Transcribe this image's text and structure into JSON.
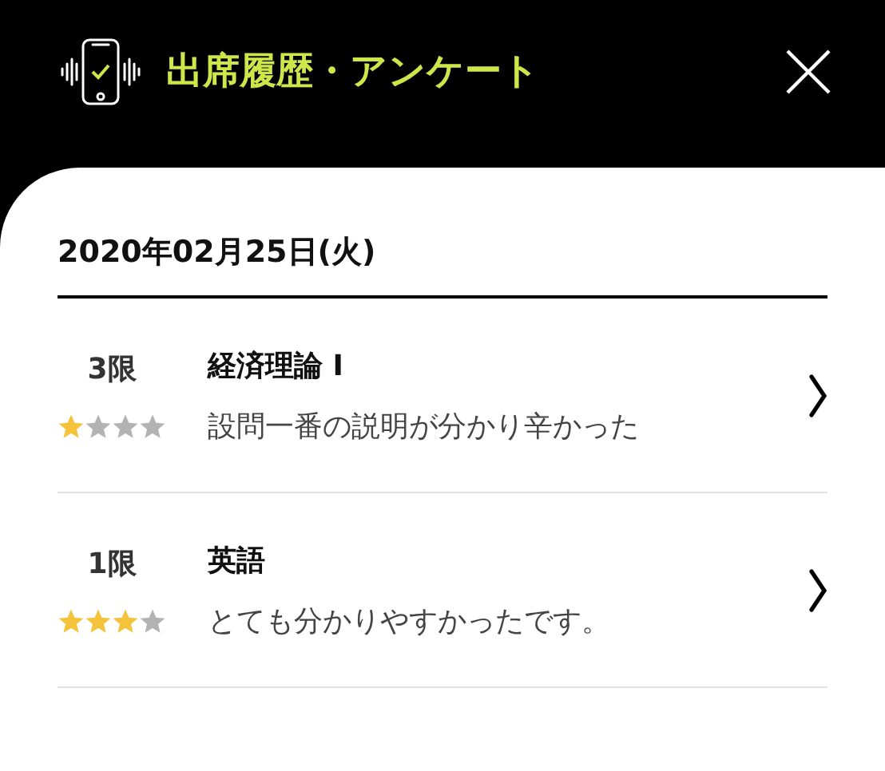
{
  "header": {
    "title": "出席履歴・アンケート"
  },
  "date": "2020年02月25日(火)",
  "entries": [
    {
      "period": "3限",
      "stars": 1,
      "subject": "経済理論 I",
      "comment": "設問一番の説明が分かり辛かった"
    },
    {
      "period": "1限",
      "stars": 3,
      "subject": "英語",
      "comment": "とても分かりやすかったです。"
    }
  ]
}
